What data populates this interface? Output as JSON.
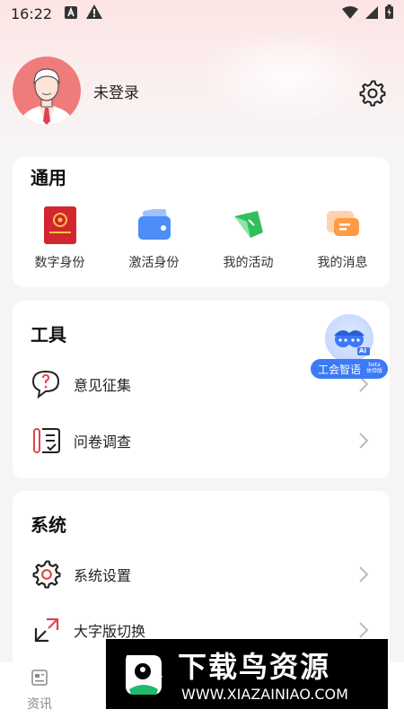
{
  "status_bar": {
    "time": "16:22"
  },
  "profile": {
    "login_text": "未登录"
  },
  "general": {
    "title": "通用",
    "items": [
      {
        "label": "数字身份",
        "icon": "union-id-card-icon"
      },
      {
        "label": "激活身份",
        "icon": "wallet-card-icon"
      },
      {
        "label": "我的活动",
        "icon": "flag-icon"
      },
      {
        "label": "我的消息",
        "icon": "message-icon"
      }
    ]
  },
  "tools": {
    "title": "工具",
    "items": [
      {
        "label": "意见征集",
        "icon": "feedback-chat-icon"
      },
      {
        "label": "问卷调查",
        "icon": "survey-icon"
      }
    ]
  },
  "system": {
    "title": "系统",
    "items": [
      {
        "label": "系统设置",
        "icon": "gear-icon"
      },
      {
        "label": "大字版切换",
        "icon": "expand-arrows-icon"
      }
    ]
  },
  "ai_assistant": {
    "label": "工会智语",
    "badge": "AI",
    "beta": "beta",
    "beta_sub": "体验版"
  },
  "bottom_nav": {
    "news_label": "资讯"
  },
  "watermark": {
    "title": "下载鸟资源",
    "url": "WWW.XIAZAINIAO.COM"
  },
  "colors": {
    "accent_red": "#e2434b",
    "ai_blue": "#3c79f5"
  }
}
